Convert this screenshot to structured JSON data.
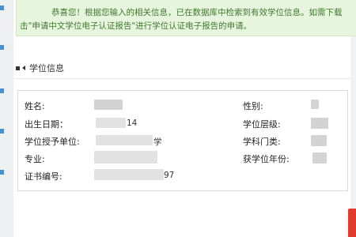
{
  "notice": {
    "line1": "恭喜您！根据您输入的相关信息，已在数据库中检索到有效学位信息。如需下载",
    "line2": "击\"申请中文学位电子认证报告\"进行学位认证电子报告的申请。"
  },
  "section": {
    "title": "学位信息"
  },
  "fields": {
    "name": {
      "label": "姓名:"
    },
    "gender": {
      "label": "性别:"
    },
    "birth": {
      "label": "出生日期：",
      "value_fragment": "14"
    },
    "degree_level": {
      "label": "学位层级:"
    },
    "institution": {
      "label": "学位授予单位:",
      "value_fragment": "学"
    },
    "discipline": {
      "label": "学科门类:"
    },
    "major": {
      "label": "专业:"
    },
    "award_year": {
      "label": "获学位年份:"
    },
    "cert_no": {
      "label": "证书编号:",
      "value_fragment": "97"
    }
  },
  "colors": {
    "notice_bg": "#e7f5df",
    "notice_text": "#3f7a2c",
    "accent_red": "#e23b2e",
    "frame_blue": "#4a8fd0"
  }
}
